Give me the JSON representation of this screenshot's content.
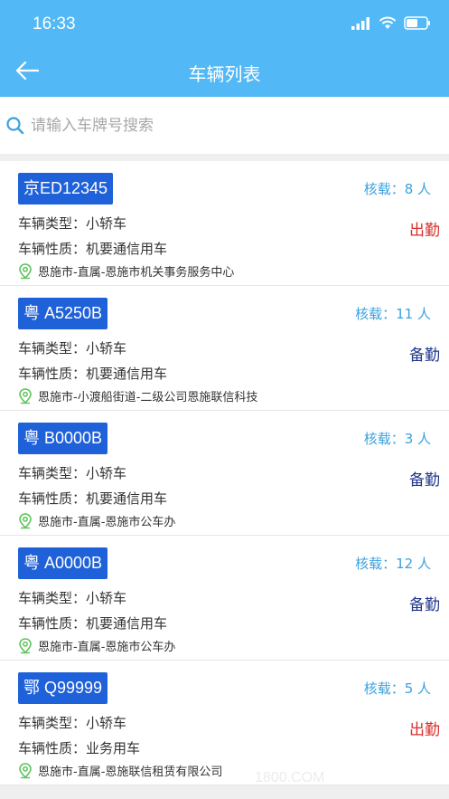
{
  "status_bar": {
    "time": "16:33"
  },
  "nav": {
    "title": "车辆列表"
  },
  "search": {
    "placeholder": "请输入车牌号搜索"
  },
  "vehicles": [
    {
      "plate": "京ED12345",
      "capacity": "核载：8 人",
      "type": "车辆类型：小轿车",
      "nature": "车辆性质：机要通信用车",
      "status": "出勤",
      "status_kind": "out",
      "org": "恩施市-直属-恩施市机关事务服务中心"
    },
    {
      "plate": "粤 A5250B",
      "capacity": "核载：11 人",
      "type": "车辆类型：小轿车",
      "nature": "车辆性质：机要通信用车",
      "status": "备勤",
      "status_kind": "standby",
      "org": "恩施市-小渡船街道-二级公司恩施联信科技"
    },
    {
      "plate": "粤 B0000B",
      "capacity": "核载：3 人",
      "type": "车辆类型：小轿车",
      "nature": "车辆性质：机要通信用车",
      "status": "备勤",
      "status_kind": "standby",
      "org": "恩施市-直属-恩施市公车办"
    },
    {
      "plate": "粤 A0000B",
      "capacity": "核载：12 人",
      "type": "车辆类型：小轿车",
      "nature": "车辆性质：机要通信用车",
      "status": "备勤",
      "status_kind": "standby",
      "org": "恩施市-直属-恩施市公车办"
    },
    {
      "plate": "鄂 Q99999",
      "capacity": "核载：5 人",
      "type": "车辆类型：小轿车",
      "nature": "车辆性质：业务用车",
      "status": "出勤",
      "status_kind": "out",
      "org": "恩施市-直属-恩施联信租赁有限公司"
    }
  ],
  "watermark": "1800.COM",
  "colors": {
    "header": "#52b8f6",
    "plate_bg": "#1f61d9",
    "out": "#d9302a",
    "standby": "#203689",
    "capacity": "#3ba1de",
    "pin": "#5cc35a"
  },
  "icons": {
    "back": "arrow-left-icon",
    "search": "search-icon",
    "location": "location-pin-icon",
    "signal": "signal-icon",
    "wifi": "wifi-icon",
    "battery": "battery-icon"
  }
}
